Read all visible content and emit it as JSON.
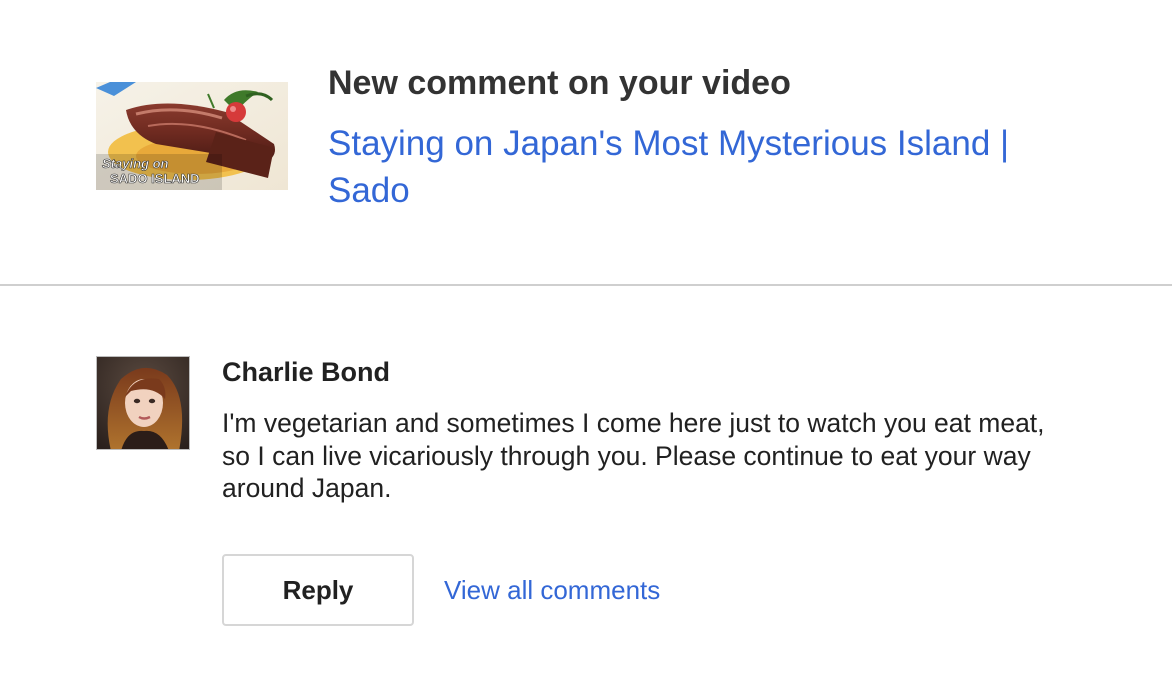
{
  "notification": {
    "title": "New comment on your video",
    "video_title": "Staying on Japan's Most Mysterious Island | Sado",
    "thumbnail": {
      "icon": "video-thumbnail-steak",
      "overlay_line1": "Staying on",
      "overlay_line2": "SADO ISLAND"
    }
  },
  "comment": {
    "author": "Charlie Bond",
    "avatar_icon": "user-avatar",
    "text": "I'm vegetarian and sometimes I come here just to watch you eat meat, so I can live vicariously through you. Please continue to eat your way around Japan."
  },
  "actions": {
    "reply_label": "Reply",
    "view_all_label": "View all comments"
  },
  "colors": {
    "link": "#3367d6",
    "title": "#333333",
    "text": "#212121",
    "divider": "#cfcfcf",
    "button_border": "#d6d6d6"
  }
}
